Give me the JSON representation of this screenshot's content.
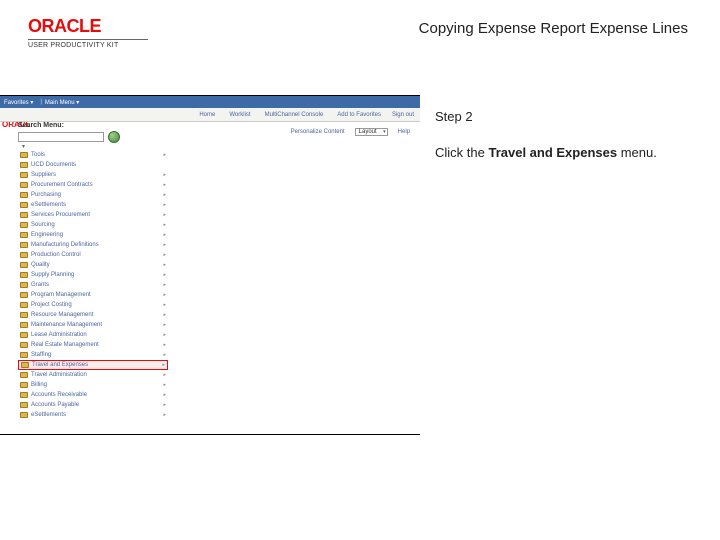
{
  "header": {
    "brand": "ORACLE",
    "brand_sub": "USER PRODUCTIVITY KIT",
    "title": "Copying Expense Report Expense Lines"
  },
  "instruction": {
    "step_label": "Step 2",
    "body_prefix": "Click the ",
    "body_bold": "Travel and Expenses",
    "body_suffix": " menu."
  },
  "screenshot": {
    "topbar": {
      "favorites": "Favorites ▾",
      "main": "Main Menu ▾"
    },
    "brand": "ORACL",
    "tabs": {
      "home": "Home",
      "worklist": "Worklist",
      "mcf": "MultiChannel Console",
      "al": "Add to Favorites",
      "signout": "Sign out"
    },
    "search": {
      "label": "Search Menu:",
      "arrow": "▾"
    },
    "personalize": {
      "label": "Personalize Content",
      "layout": "Layout",
      "help": "Help"
    },
    "menu": {
      "items": [
        {
          "label": "Tools",
          "chev": true
        },
        {
          "label": "UCD Documents",
          "chev": false
        },
        {
          "label": "Suppliers",
          "chev": true
        },
        {
          "label": "Procurement Contracts",
          "chev": true
        },
        {
          "label": "Purchasing",
          "chev": true
        },
        {
          "label": "eSettlements",
          "chev": true
        },
        {
          "label": "Services Procurement",
          "chev": true
        },
        {
          "label": "Sourcing",
          "chev": true
        },
        {
          "label": "Engineering",
          "chev": true
        },
        {
          "label": "Manufacturing Definitions",
          "chev": true
        },
        {
          "label": "Production Control",
          "chev": true
        },
        {
          "label": "Quality",
          "chev": true
        },
        {
          "label": "Supply Planning",
          "chev": true
        },
        {
          "label": "Grants",
          "chev": true
        },
        {
          "label": "Program Management",
          "chev": true
        },
        {
          "label": "Project Costing",
          "chev": true
        },
        {
          "label": "Resource Management",
          "chev": true
        },
        {
          "label": "Maintenance Management",
          "chev": true
        },
        {
          "label": "Lease Administration",
          "chev": true
        },
        {
          "label": "Real Estate Management",
          "chev": true
        },
        {
          "label": "Staffing",
          "chev": true
        }
      ],
      "highlight": {
        "label": "Travel and Expenses",
        "chev": true
      },
      "items_after": [
        {
          "label": "Travel Administration",
          "chev": true
        },
        {
          "label": "Billing",
          "chev": true
        },
        {
          "label": "Accounts Receivable",
          "chev": true
        },
        {
          "label": "Accounts Payable",
          "chev": true
        },
        {
          "label": "eSettlements",
          "chev": true
        }
      ]
    }
  }
}
